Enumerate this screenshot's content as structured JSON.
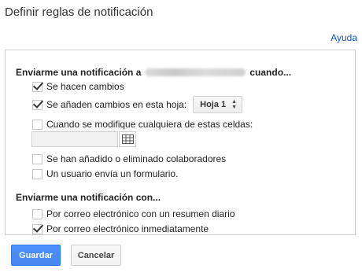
{
  "dialog": {
    "title": "Definir reglas de notificación",
    "help_link": "Ayuda"
  },
  "notify_when": {
    "heading_prefix": "Enviarme una notificación a",
    "heading_suffix": "cuando...",
    "options": [
      {
        "label": "Se hacen cambios",
        "checked": true
      },
      {
        "label": "Se añaden cambios en esta hoja:",
        "checked": true
      },
      {
        "label": "Cuando se modifique cualquiera de estas celdas:",
        "checked": false
      },
      {
        "label": "Se han añadido o eliminado colaboradores",
        "checked": false
      },
      {
        "label": "Un usuario envía un formulario.",
        "checked": false
      }
    ],
    "sheet_select": {
      "value": "Hoja 1"
    },
    "range_input": {
      "value": ""
    }
  },
  "notify_with": {
    "heading": "Enviarme una notificación con...",
    "options": [
      {
        "label": "Por correo electrónico con un resumen diario",
        "checked": false
      },
      {
        "label": "Por correo electrónico inmediatamente",
        "checked": true
      }
    ]
  },
  "buttons": {
    "save": "Guardar",
    "cancel": "Cancelar"
  },
  "colors": {
    "primary_button": "#4d90fe",
    "link": "#1155cc",
    "panel_border": "#d0d0d0"
  }
}
